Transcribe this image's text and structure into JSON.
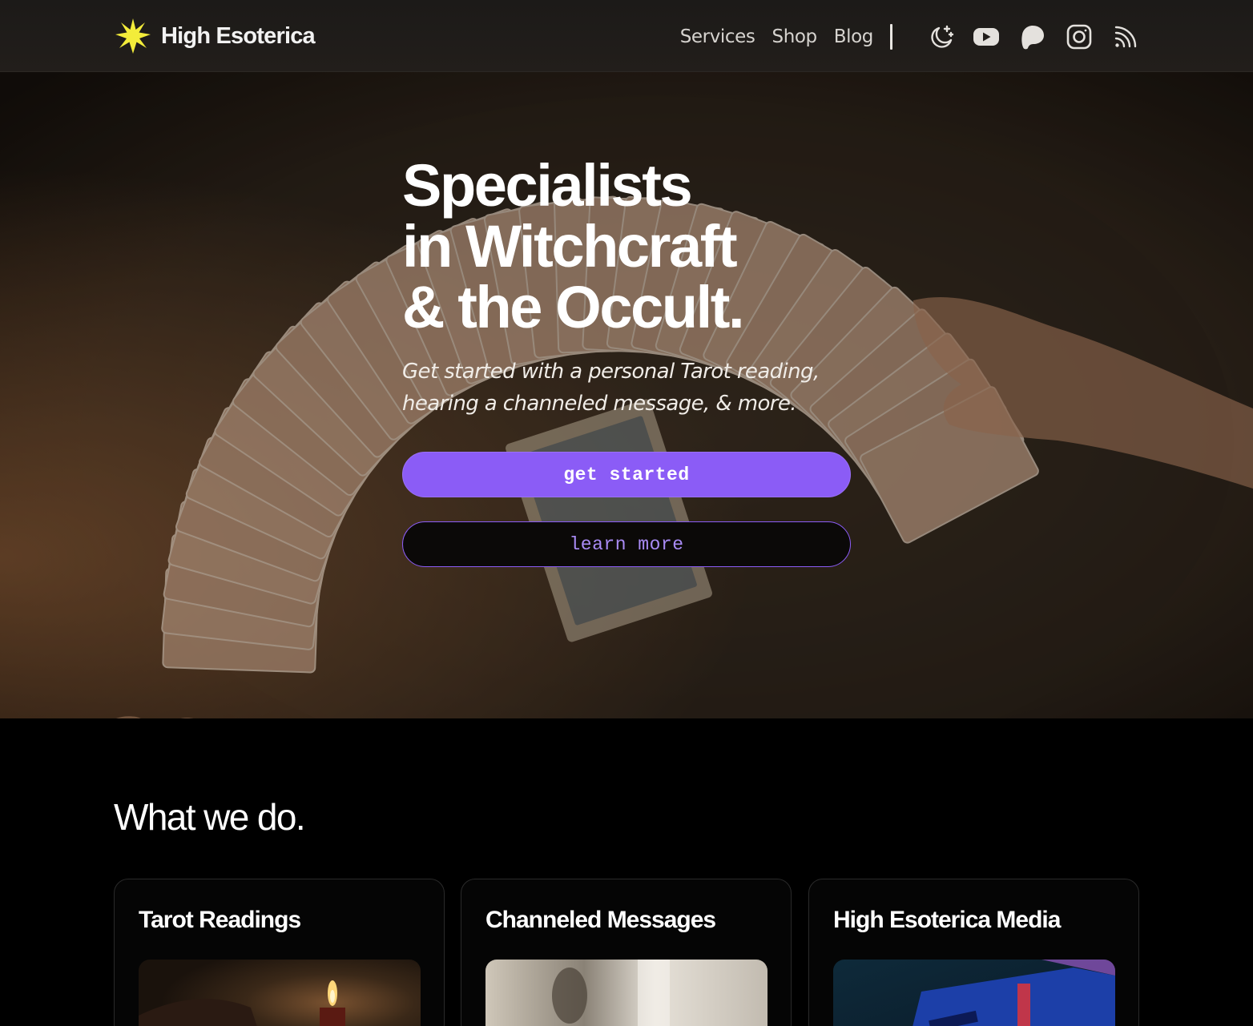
{
  "brand": {
    "name": "High Esoterica",
    "star_color": "#f3ec3a"
  },
  "nav": {
    "links": [
      "Services",
      "Shop",
      "Blog"
    ],
    "icons": [
      "moon-stars-icon",
      "youtube-icon",
      "patreon-icon",
      "instagram-icon",
      "rss-icon"
    ]
  },
  "hero": {
    "title_lines": [
      "Specialists",
      "in Witchcraft",
      "& the Occult."
    ],
    "subtitle_lines": [
      "Get started with a personal Tarot reading,",
      "hearing a channeled message, & more."
    ],
    "primary_button": "get started",
    "secondary_button": "learn more",
    "accent": "#8b5cf6"
  },
  "what_we_do": {
    "title": "What we do.",
    "cards": [
      {
        "title": "Tarot Readings",
        "thumb": "candle-image"
      },
      {
        "title": "Channeled Messages",
        "thumb": "blurred-light-image"
      },
      {
        "title": "High Esoterica Media",
        "thumb": "camera-image"
      }
    ]
  }
}
